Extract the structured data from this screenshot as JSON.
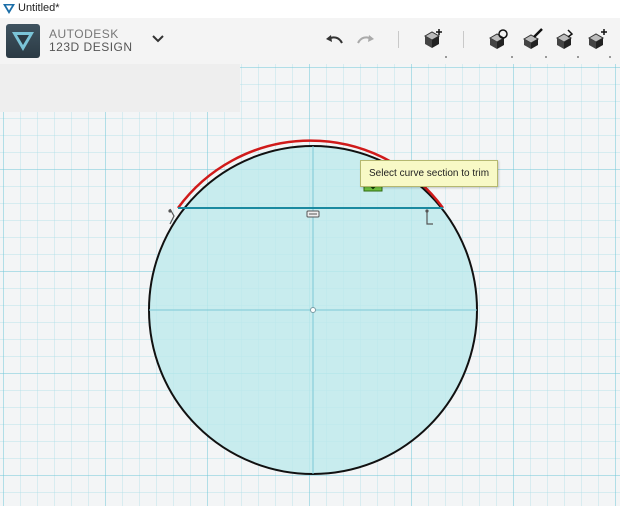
{
  "window": {
    "title": "Untitled*"
  },
  "brand": {
    "line1": "AUTODESK",
    "line2": "123D DESIGN"
  },
  "toolbar": {
    "menu_icon": "chevron-down-icon",
    "undo_icon": "undo-icon",
    "redo_icon": "redo-icon",
    "tools": [
      "primitive-box-icon",
      "sketch-icon",
      "construct-icon",
      "modify-icon",
      "pattern-icon"
    ]
  },
  "sketch": {
    "tooltip": "Select curve section to trim",
    "colors": {
      "fill": "#bdeaec",
      "outline": "#111111",
      "highlight": "#d01a1a",
      "chord": "#1a8aa0",
      "grid": "#a8dbe6"
    }
  }
}
